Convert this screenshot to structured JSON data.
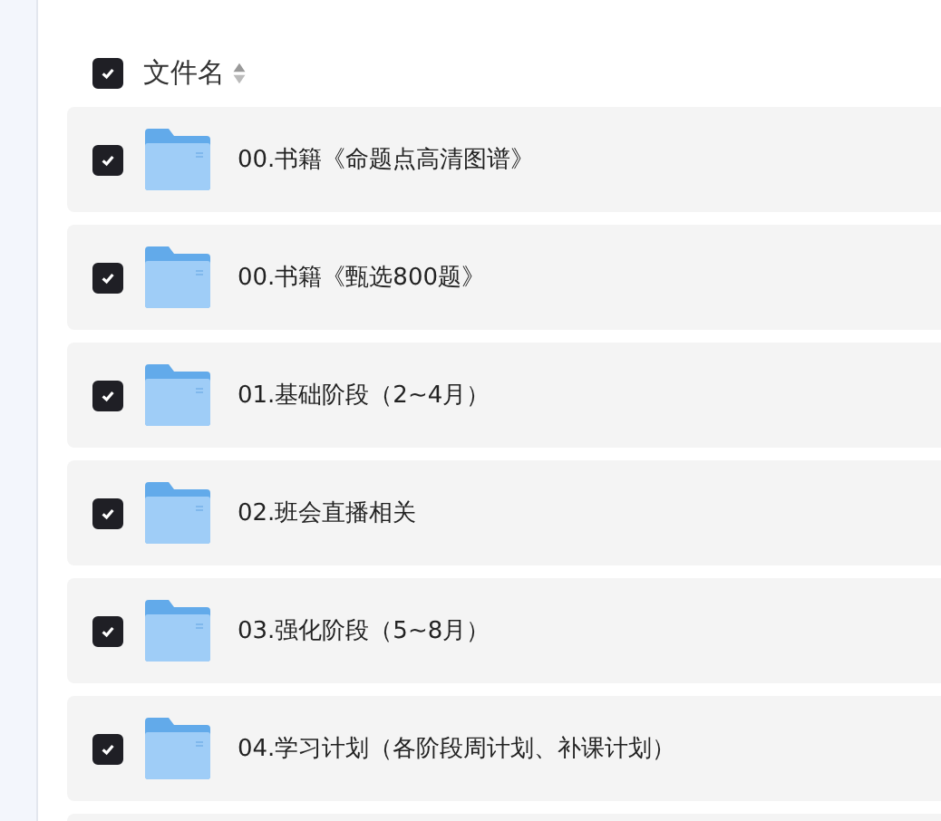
{
  "header": {
    "checked": true,
    "label": "文件名"
  },
  "files": [
    {
      "name": "00.书籍《命题点高清图谱》",
      "checked": true
    },
    {
      "name": "00.书籍《甄选800题》",
      "checked": true
    },
    {
      "name": "01.基础阶段（2~4月）",
      "checked": true
    },
    {
      "name": "02.班会直播相关",
      "checked": true
    },
    {
      "name": "03.强化阶段（5~8月）",
      "checked": true
    },
    {
      "name": "04.学习计划（各阶段周计划、补课计划）",
      "checked": true
    }
  ]
}
